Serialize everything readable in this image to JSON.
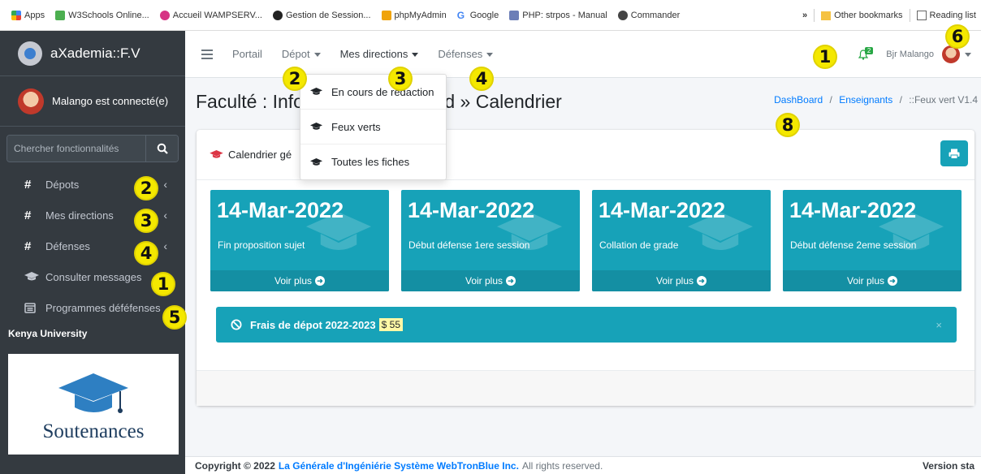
{
  "bookmarks": {
    "items": [
      "Apps",
      "W3Schools Online...",
      "Accueil WAMPSERV...",
      "Gestion de Session...",
      "phpMyAdmin",
      "Google",
      "PHP: strpos - Manual",
      "Commander"
    ],
    "more": "»",
    "other": "Other bookmarks",
    "reading": "Reading list"
  },
  "brand": {
    "name": "aXademia::F.V"
  },
  "user": {
    "status": "Malango est connecté(e)"
  },
  "search": {
    "placeholder": "Chercher fonctionnalités"
  },
  "sidebar": {
    "items": [
      {
        "label": "Dépots",
        "icon": "hash-icon"
      },
      {
        "label": "Mes directions",
        "icon": "hash-icon"
      },
      {
        "label": "Défenses",
        "icon": "hash-icon"
      },
      {
        "label": "Consulter messages",
        "icon": "graduation-cap-icon"
      },
      {
        "label": "Programmes déféfenses",
        "icon": "calendar-icon"
      }
    ],
    "section": "Kenya University",
    "logo_text": "Soutenances"
  },
  "topnav": {
    "items": [
      "Portail",
      "Dépot",
      "Mes directions",
      "Défenses"
    ],
    "badge": "2",
    "greeting": "Bjr Malango"
  },
  "dropdown": {
    "items": [
      "En cours de rédaction",
      "Feux verts",
      "Toutes les fiches"
    ]
  },
  "page": {
    "title": "Faculté : Info… DashBoard » Calendrier",
    "title_left": "Faculté : Info",
    "title_right": "hBoard » Calendrier"
  },
  "breadcrumb": {
    "items": [
      "DashBoard",
      "Enseignants",
      "::Feux vert V1.4"
    ],
    "sep": "/"
  },
  "card": {
    "title": "Calendrier gé",
    "boxes": [
      {
        "date": "14-Mar-2022",
        "label": "Fin proposition sujet",
        "link": "Voir plus"
      },
      {
        "date": "14-Mar-2022",
        "label": "Début défense 1ere session",
        "link": "Voir plus"
      },
      {
        "date": "14-Mar-2022",
        "label": "Collation de grade",
        "link": "Voir plus"
      },
      {
        "date": "14-Mar-2022",
        "label": "Début défense 2eme session",
        "link": "Voir plus"
      }
    ],
    "alert": {
      "text": "Frais de dépot 2022-2023",
      "price": "$ 55",
      "close": "×"
    }
  },
  "footer": {
    "copyright": "Copyright © 2022",
    "org": "La Générale d'Ingéniérie Système WebTronBlue Inc.",
    "rights": "All rights reserved.",
    "version": "Version sta"
  },
  "markers": [
    "1",
    "2",
    "3",
    "4",
    "5",
    "6",
    "8",
    "2",
    "3",
    "4",
    "1"
  ],
  "colors": {
    "sidebar": "#343a40",
    "accent": "#17a2b8",
    "link": "#007bff",
    "marker": "#f4e800"
  }
}
